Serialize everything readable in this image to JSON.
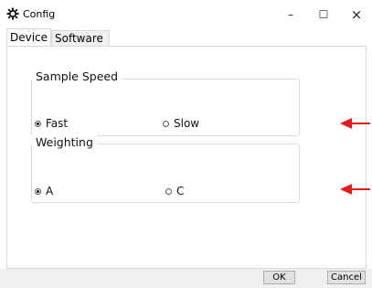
{
  "window": {
    "title": "Config",
    "minimize": "–",
    "maximize": "☐",
    "close": "×"
  },
  "tabs": [
    {
      "label": "Device",
      "active": true
    },
    {
      "label": "Software",
      "active": false
    }
  ],
  "groups": {
    "sample_speed": {
      "legend": "Sample Speed",
      "options": [
        {
          "label": "Fast",
          "selected": true
        },
        {
          "label": "Slow",
          "selected": false
        }
      ]
    },
    "weighting": {
      "legend": "Weighting",
      "options": [
        {
          "label": "A",
          "selected": true
        },
        {
          "label": "C",
          "selected": false
        }
      ]
    }
  },
  "buttons": {
    "ok": "OK",
    "cancel": "Cancel"
  },
  "colors": {
    "arrow": "#e11d1d"
  }
}
